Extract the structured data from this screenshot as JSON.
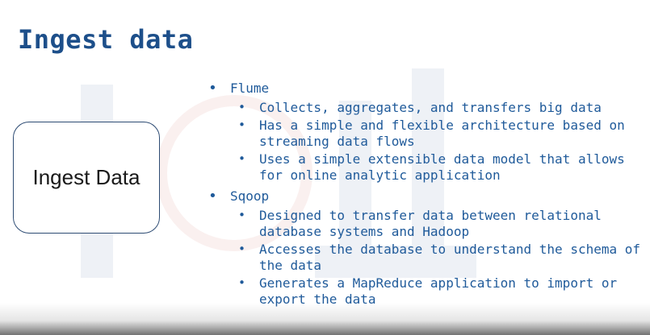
{
  "slide": {
    "title": "Ingest data",
    "box_label": "Ingest Data",
    "bullets": [
      {
        "label": "Flume",
        "items": [
          "Collects, aggregates, and transfers big data",
          "Has a simple and flexible architecture based on streaming data flows",
          "Uses a simple extensible data model that allows for online analytic application"
        ]
      },
      {
        "label": "Sqoop",
        "items": [
          "Designed to transfer data between relational database systems and Hadoop",
          "Accesses the database to understand the schema of the data",
          "Generates a MapReduce application to import or export the data"
        ]
      }
    ]
  },
  "bullet_glyph": "•",
  "colors": {
    "title": "#1d4f8a",
    "bullet_text": "#1f5a9a",
    "box_border": "#2d4b73"
  }
}
